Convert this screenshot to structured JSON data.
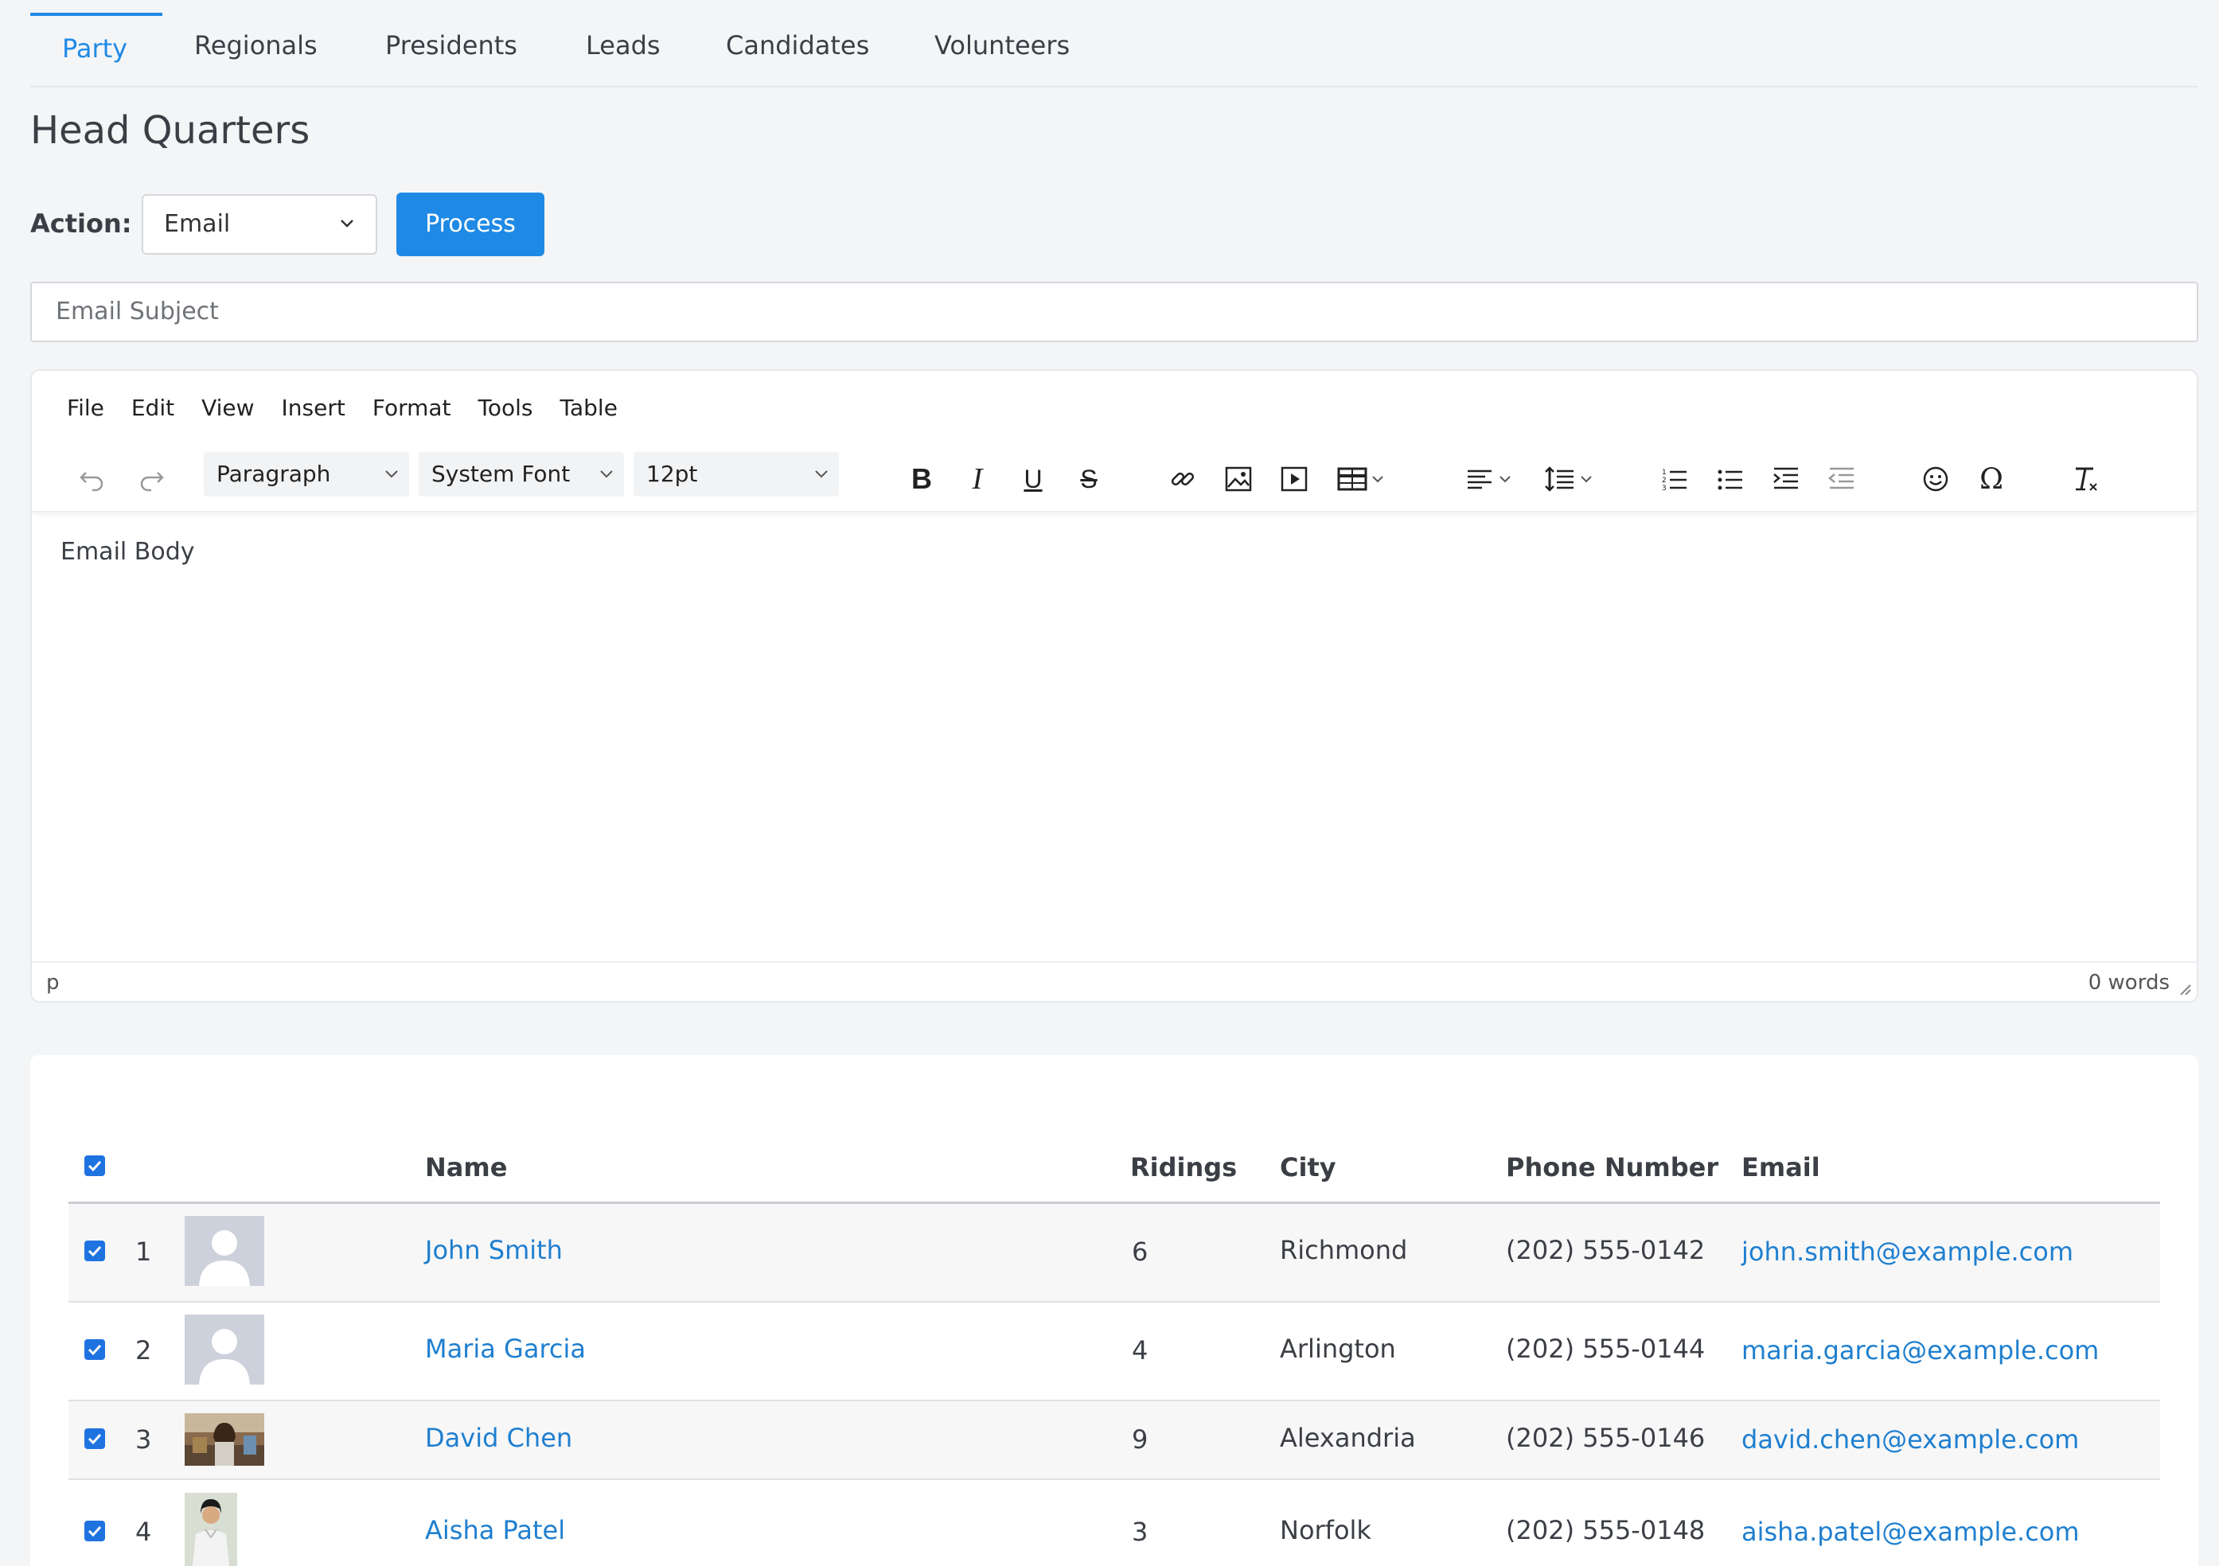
{
  "tabs": [
    {
      "label": "Party",
      "active": true
    },
    {
      "label": "Regionals"
    },
    {
      "label": "Presidents"
    },
    {
      "label": "Leads"
    },
    {
      "label": "Candidates"
    },
    {
      "label": "Volunteers"
    }
  ],
  "page_title": "Head Quarters",
  "action": {
    "label": "Action:",
    "selected": "Email",
    "process_label": "Process"
  },
  "subject": {
    "placeholder": "Email Subject"
  },
  "editor": {
    "menu": [
      "File",
      "Edit",
      "View",
      "Insert",
      "Format",
      "Tools",
      "Table"
    ],
    "block_format": "Paragraph",
    "font_family": "System Font",
    "font_size": "12pt",
    "body_placeholder": "Email Body",
    "status_path": "p",
    "word_count": "0 words",
    "toolbar_icons": [
      "undo-icon",
      "redo-icon",
      "bold-icon",
      "italic-icon",
      "underline-icon",
      "strikethrough-icon",
      "link-icon",
      "image-icon",
      "media-icon",
      "table-icon",
      "align-icon",
      "line-height-icon",
      "numbered-list-icon",
      "bullet-list-icon",
      "indent-icon",
      "outdent-icon",
      "emoji-icon",
      "special-char-icon",
      "clear-format-icon"
    ]
  },
  "table": {
    "headers": {
      "name": "Name",
      "ridings": "Ridings",
      "city": "City",
      "phone": "Phone Number",
      "email": "Email"
    },
    "rows": [
      {
        "index": "1",
        "name": "John Smith",
        "ridings": "6",
        "city": "Richmond",
        "phone": "(202) 555-0142",
        "email": "john.smith@example.com",
        "checked": true,
        "avatar": "placeholder-avatar"
      },
      {
        "index": "2",
        "name": "Maria Garcia",
        "ridings": "4",
        "city": "Arlington",
        "phone": "(202) 555-0144",
        "email": "maria.garcia@example.com",
        "checked": true,
        "avatar": "placeholder-avatar"
      },
      {
        "index": "3",
        "name": "David Chen",
        "ridings": "9",
        "city": "Alexandria",
        "phone": "(202) 555-0146",
        "email": "david.chen@example.com",
        "checked": true,
        "avatar": "photo-avatar"
      },
      {
        "index": "4",
        "name": "Aisha Patel",
        "ridings": "3",
        "city": "Norfolk",
        "phone": "(202) 555-0148",
        "email": "aisha.patel@example.com",
        "checked": true,
        "avatar": "photo-avatar"
      }
    ]
  },
  "colors": {
    "accent": "#1f8ae6",
    "link": "#1f7fcf",
    "checkbox": "#1f73e0"
  }
}
